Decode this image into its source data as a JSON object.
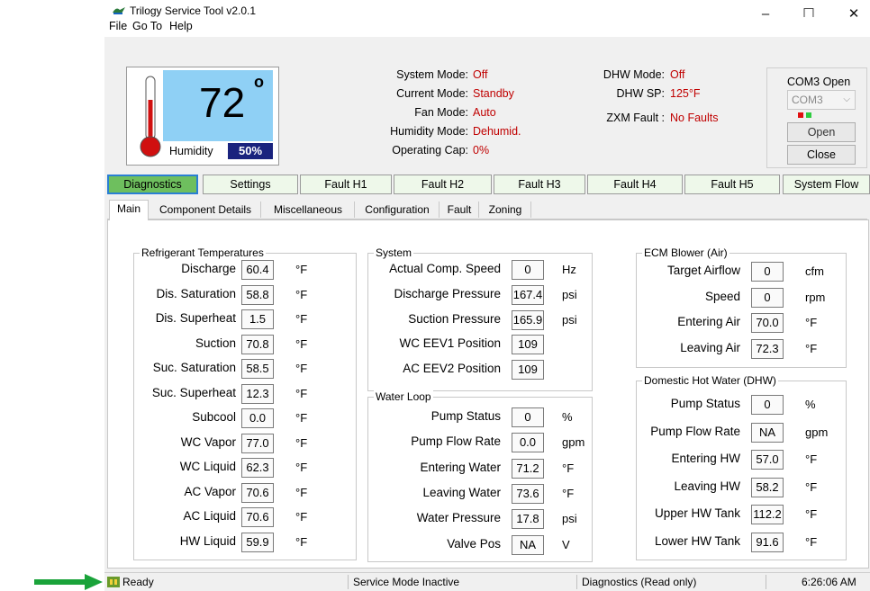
{
  "app": {
    "title": "Trilogy Service Tool  v2.0.1"
  },
  "menu": [
    "File",
    "Go To",
    "Help"
  ],
  "thermostat": {
    "temp": "72",
    "degree": "o",
    "humidity_label": "Humidity",
    "humidity_value": "50%"
  },
  "status_info": [
    {
      "label": "System Mode:",
      "value": "Off"
    },
    {
      "label": "Current Mode:",
      "value": "Standby"
    },
    {
      "label": "Fan Mode:",
      "value": "Auto"
    },
    {
      "label": "Humidity Mode:",
      "value": "Dehumid."
    },
    {
      "label": "Operating Cap:",
      "value": "0%"
    }
  ],
  "dhw_info": [
    {
      "label": "DHW Mode:",
      "value": "Off"
    },
    {
      "label": "DHW SP:",
      "value": "125°F"
    },
    {
      "label": "ZXM Fault :",
      "value": "No Faults"
    }
  ],
  "com": {
    "title": "COM3 Open",
    "port": "COM3",
    "open": "Open",
    "close": "Close"
  },
  "main_tabs": [
    "Diagnostics",
    "Settings",
    "Fault H1",
    "Fault H2",
    "Fault H3",
    "Fault H4",
    "Fault H5",
    "System Flow"
  ],
  "sub_tabs": [
    "Main",
    "Component Details",
    "Miscellaneous",
    "Configuration",
    "Fault",
    "Zoning"
  ],
  "refrigerant": {
    "title": "Refrigerant Temperatures",
    "rows": [
      {
        "label": "Discharge",
        "value": "60.4",
        "unit": "°F"
      },
      {
        "label": "Dis. Saturation",
        "value": "58.8",
        "unit": "°F"
      },
      {
        "label": "Dis. Superheat",
        "value": "1.5",
        "unit": "°F"
      },
      {
        "label": "Suction",
        "value": "70.8",
        "unit": "°F"
      },
      {
        "label": "Suc. Saturation",
        "value": "58.5",
        "unit": "°F"
      },
      {
        "label": "Suc. Superheat",
        "value": "12.3",
        "unit": "°F"
      },
      {
        "label": "Subcool",
        "value": "0.0",
        "unit": "°F"
      },
      {
        "label": "WC Vapor",
        "value": "77.0",
        "unit": "°F"
      },
      {
        "label": "WC Liquid",
        "value": "62.3",
        "unit": "°F"
      },
      {
        "label": "AC Vapor",
        "value": "70.6",
        "unit": "°F"
      },
      {
        "label": "AC Liquid",
        "value": "70.6",
        "unit": "°F"
      },
      {
        "label": "HW Liquid",
        "value": "59.9",
        "unit": "°F"
      }
    ]
  },
  "system": {
    "title": "System",
    "rows": [
      {
        "label": "Actual Comp. Speed",
        "value": "0",
        "unit": "Hz"
      },
      {
        "label": "Discharge Pressure",
        "value": "167.4",
        "unit": "psi"
      },
      {
        "label": "Suction Pressure",
        "value": "165.9",
        "unit": "psi"
      },
      {
        "label": "WC EEV1 Position",
        "value": "109",
        "unit": ""
      },
      {
        "label": "AC EEV2 Position",
        "value": "109",
        "unit": ""
      }
    ]
  },
  "water_loop": {
    "title": "Water Loop",
    "rows": [
      {
        "label": "Pump Status",
        "value": "0",
        "unit": "%"
      },
      {
        "label": "Pump Flow Rate",
        "value": "0.0",
        "unit": "gpm"
      },
      {
        "label": "Entering Water",
        "value": "71.2",
        "unit": "°F"
      },
      {
        "label": "Leaving Water",
        "value": "73.6",
        "unit": "°F"
      },
      {
        "label": "Water Pressure",
        "value": "17.8",
        "unit": "psi"
      },
      {
        "label": "Valve Pos",
        "value": "NA",
        "unit": "V"
      }
    ]
  },
  "ecm": {
    "title": "ECM Blower (Air)",
    "rows": [
      {
        "label": "Target Airflow",
        "value": "0",
        "unit": "cfm"
      },
      {
        "label": "Speed",
        "value": "0",
        "unit": "rpm"
      },
      {
        "label": "Entering Air",
        "value": "70.0",
        "unit": "°F"
      },
      {
        "label": "Leaving Air",
        "value": "72.3",
        "unit": "°F"
      }
    ]
  },
  "dhw": {
    "title": "Domestic Hot Water (DHW)",
    "rows": [
      {
        "label": "Pump Status",
        "value": "0",
        "unit": "%"
      },
      {
        "label": "Pump Flow Rate",
        "value": "NA",
        "unit": "gpm"
      },
      {
        "label": "Entering HW",
        "value": "57.0",
        "unit": "°F"
      },
      {
        "label": "Leaving HW",
        "value": "58.2",
        "unit": "°F"
      },
      {
        "label": "Upper HW Tank",
        "value": "112.2",
        "unit": "°F"
      },
      {
        "label": "Lower HW Tank",
        "value": "91.6",
        "unit": "°F"
      }
    ]
  },
  "statusbar": {
    "ready": "Ready",
    "service": "Service Mode Inactive",
    "diag": "Diagnostics (Read only)",
    "time": "6:26:06 AM"
  },
  "colors": {
    "accent_green": "#6ebf5e",
    "arrow_green": "#1aa33a",
    "value_red": "#c00000",
    "humidity_bg": "#1a237e",
    "thermostat_bg": "#8fd0f5"
  }
}
